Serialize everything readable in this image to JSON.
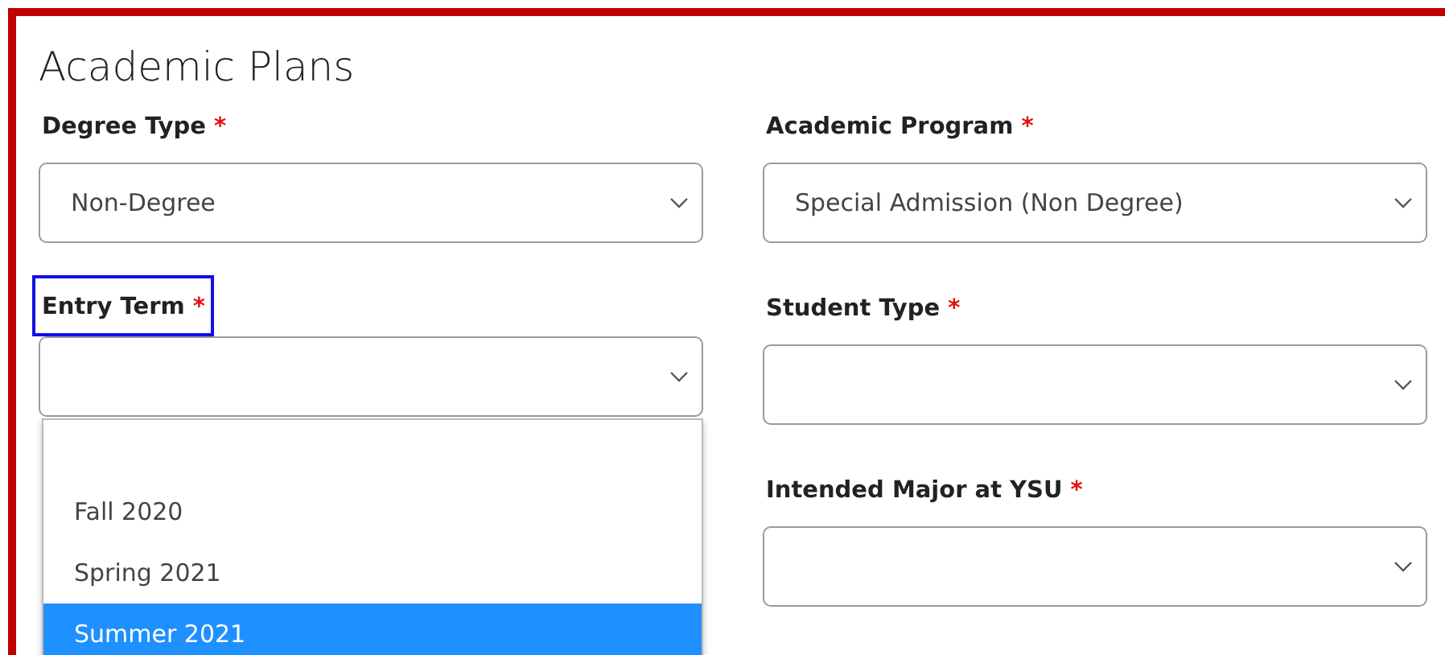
{
  "section": {
    "title": "Academic Plans"
  },
  "columns": [
    {
      "fields": [
        {
          "label": "Degree Type",
          "required_mark": "*",
          "value": "Non-Degree",
          "highlighted": false,
          "open": false
        },
        {
          "label": "Entry Term",
          "required_mark": "*",
          "highlighted": true,
          "open": true,
          "options": [
            {
              "kind": "blank",
              "selected": false
            },
            {
              "kind": "option",
              "label": "Fall 2020",
              "selected": false
            },
            {
              "kind": "option",
              "label": "Spring 2021",
              "selected": false
            },
            {
              "kind": "option",
              "label": "Summer 2021",
              "selected": true
            }
          ]
        }
      ]
    },
    {
      "fields": [
        {
          "label": "Academic Program",
          "required_mark": "*",
          "value": "Special Admission (Non Degree)",
          "highlighted": false,
          "open": false
        },
        {
          "label": "Student Type",
          "required_mark": "*",
          "highlighted": false,
          "open": false
        },
        {
          "label": "Intended Major at YSU",
          "required_mark": "*",
          "highlighted": false,
          "open": false
        }
      ]
    }
  ]
}
